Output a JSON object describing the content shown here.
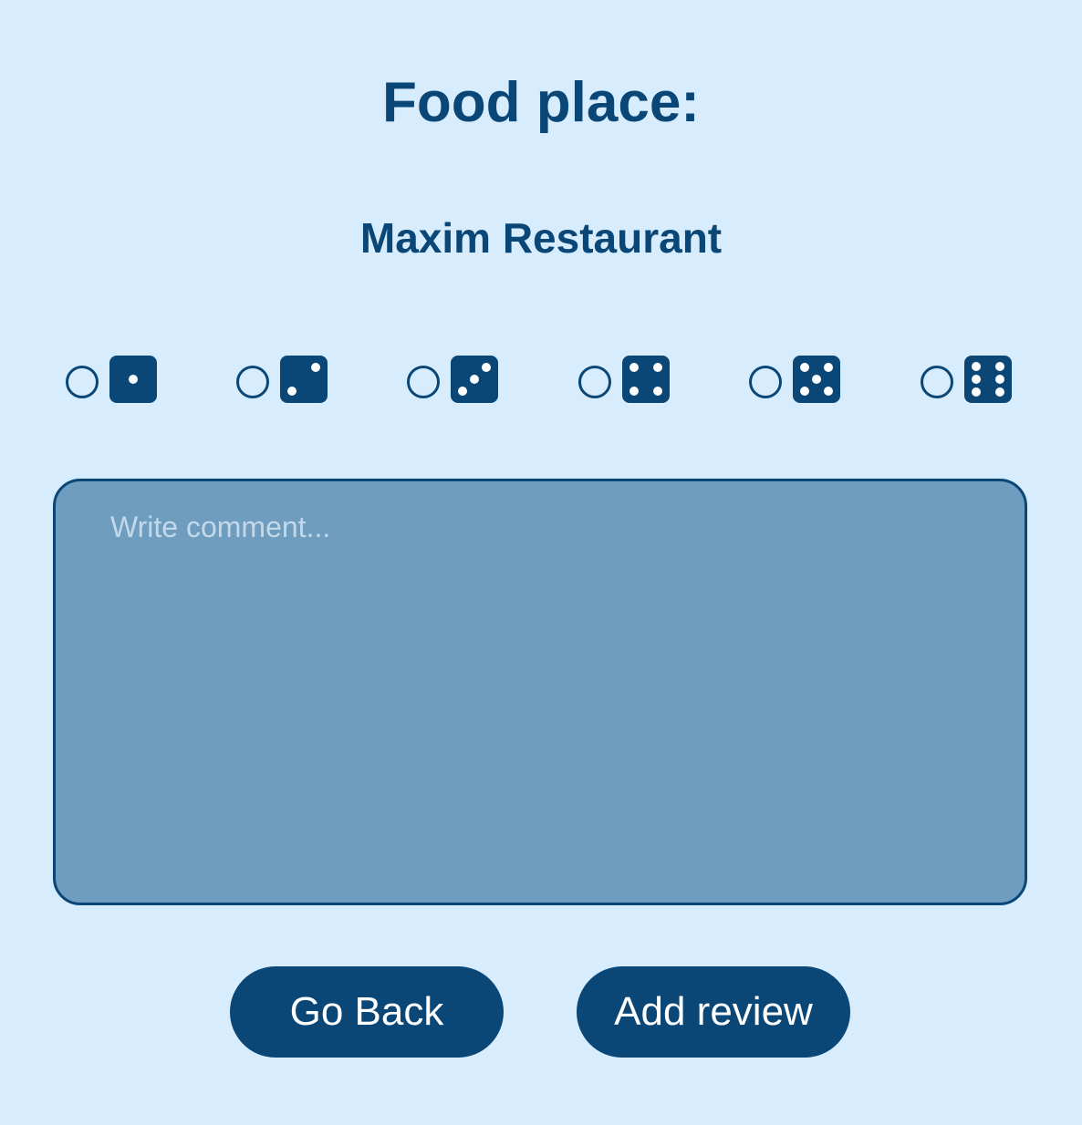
{
  "header": {
    "title": "Food place:",
    "place_name": "Maxim Restaurant"
  },
  "rating": {
    "options": [
      {
        "value": 1,
        "icon": "dice-one-icon"
      },
      {
        "value": 2,
        "icon": "dice-two-icon"
      },
      {
        "value": 3,
        "icon": "dice-three-icon"
      },
      {
        "value": 4,
        "icon": "dice-four-icon"
      },
      {
        "value": 5,
        "icon": "dice-five-icon"
      },
      {
        "value": 6,
        "icon": "dice-six-icon"
      }
    ],
    "selected": null
  },
  "comment": {
    "placeholder": "Write comment...",
    "value": ""
  },
  "actions": {
    "back_label": "Go Back",
    "add_label": "Add review"
  },
  "colors": {
    "background": "#d7ecfd",
    "primary": "#0a4777",
    "textarea_bg": "#6e9dbf",
    "placeholder": "#c3d8e8",
    "button_text": "#ffffff"
  }
}
